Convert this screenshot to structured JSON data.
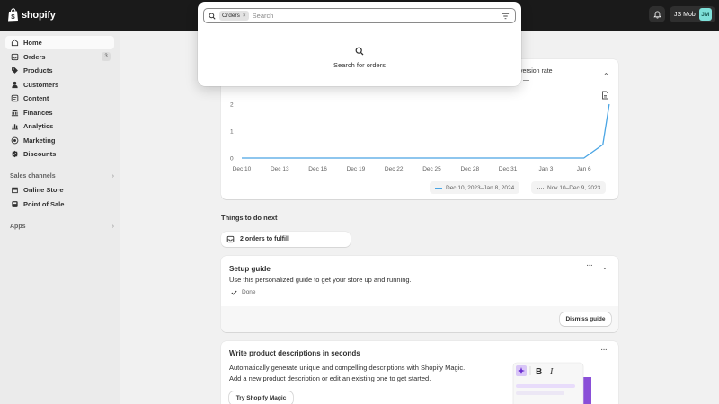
{
  "topbar": {
    "logo_text": "shopify",
    "user_name": "JS Mob",
    "avatar_initials": "JM"
  },
  "sidebar": {
    "items": [
      {
        "label": "Home",
        "icon": "home-icon",
        "active": true
      },
      {
        "label": "Orders",
        "icon": "orders-icon",
        "badge": "3"
      },
      {
        "label": "Products",
        "icon": "tag-icon"
      },
      {
        "label": "Customers",
        "icon": "person-icon"
      },
      {
        "label": "Content",
        "icon": "content-icon"
      },
      {
        "label": "Finances",
        "icon": "bank-icon"
      },
      {
        "label": "Analytics",
        "icon": "analytics-icon"
      },
      {
        "label": "Marketing",
        "icon": "target-icon"
      },
      {
        "label": "Discounts",
        "icon": "discount-icon"
      }
    ],
    "sales_channels_label": "Sales channels",
    "channels": [
      {
        "label": "Online Store",
        "icon": "store-icon"
      },
      {
        "label": "Point of Sale",
        "icon": "pos-icon"
      }
    ],
    "apps_label": "Apps"
  },
  "search": {
    "chip_label": "Orders",
    "placeholder": "Search",
    "empty_text": "Search for orders"
  },
  "chart_card": {
    "partial_label": "version rate",
    "partial_value": "—"
  },
  "chart_data": {
    "type": "line",
    "title": "",
    "xlabel": "",
    "ylabel": "",
    "x": [
      "Dec 10",
      "Dec 13",
      "Dec 16",
      "Dec 19",
      "Dec 22",
      "Dec 25",
      "Dec 28",
      "Dec 31",
      "Jan 3",
      "Jan 6"
    ],
    "yticks": [
      "2",
      "1",
      "0"
    ],
    "ylim": [
      0,
      2
    ],
    "series": [
      {
        "name": "Dec 10, 2023–Jan 8, 2024",
        "style": "solid",
        "color": "#4aa5e4",
        "points": [
          [
            0,
            0
          ],
          [
            3,
            0
          ],
          [
            6,
            0
          ],
          [
            9,
            0
          ],
          [
            12,
            0
          ],
          [
            15,
            0
          ],
          [
            18,
            0
          ],
          [
            21,
            0
          ],
          [
            24,
            0
          ],
          [
            27,
            0
          ],
          [
            28.5,
            0.5
          ],
          [
            29,
            2
          ]
        ]
      },
      {
        "name": "Nov 10–Dec 9, 2023",
        "style": "dotted",
        "color": "#9a9a9a",
        "points": []
      }
    ]
  },
  "things_to_do": {
    "title": "Things to do next",
    "item_label": "2 orders to fulfill"
  },
  "setup_guide": {
    "title": "Setup guide",
    "description": "Use this personalized guide to get your store up and running.",
    "done_label": "Done",
    "dismiss_label": "Dismiss guide"
  },
  "magic": {
    "title": "Write product descriptions in seconds",
    "line1": "Automatically generate unique and compelling descriptions with Shopify Magic.",
    "line2": "Add a new product description or edit an existing one to get started.",
    "button_label": "Try Shopify Magic"
  }
}
